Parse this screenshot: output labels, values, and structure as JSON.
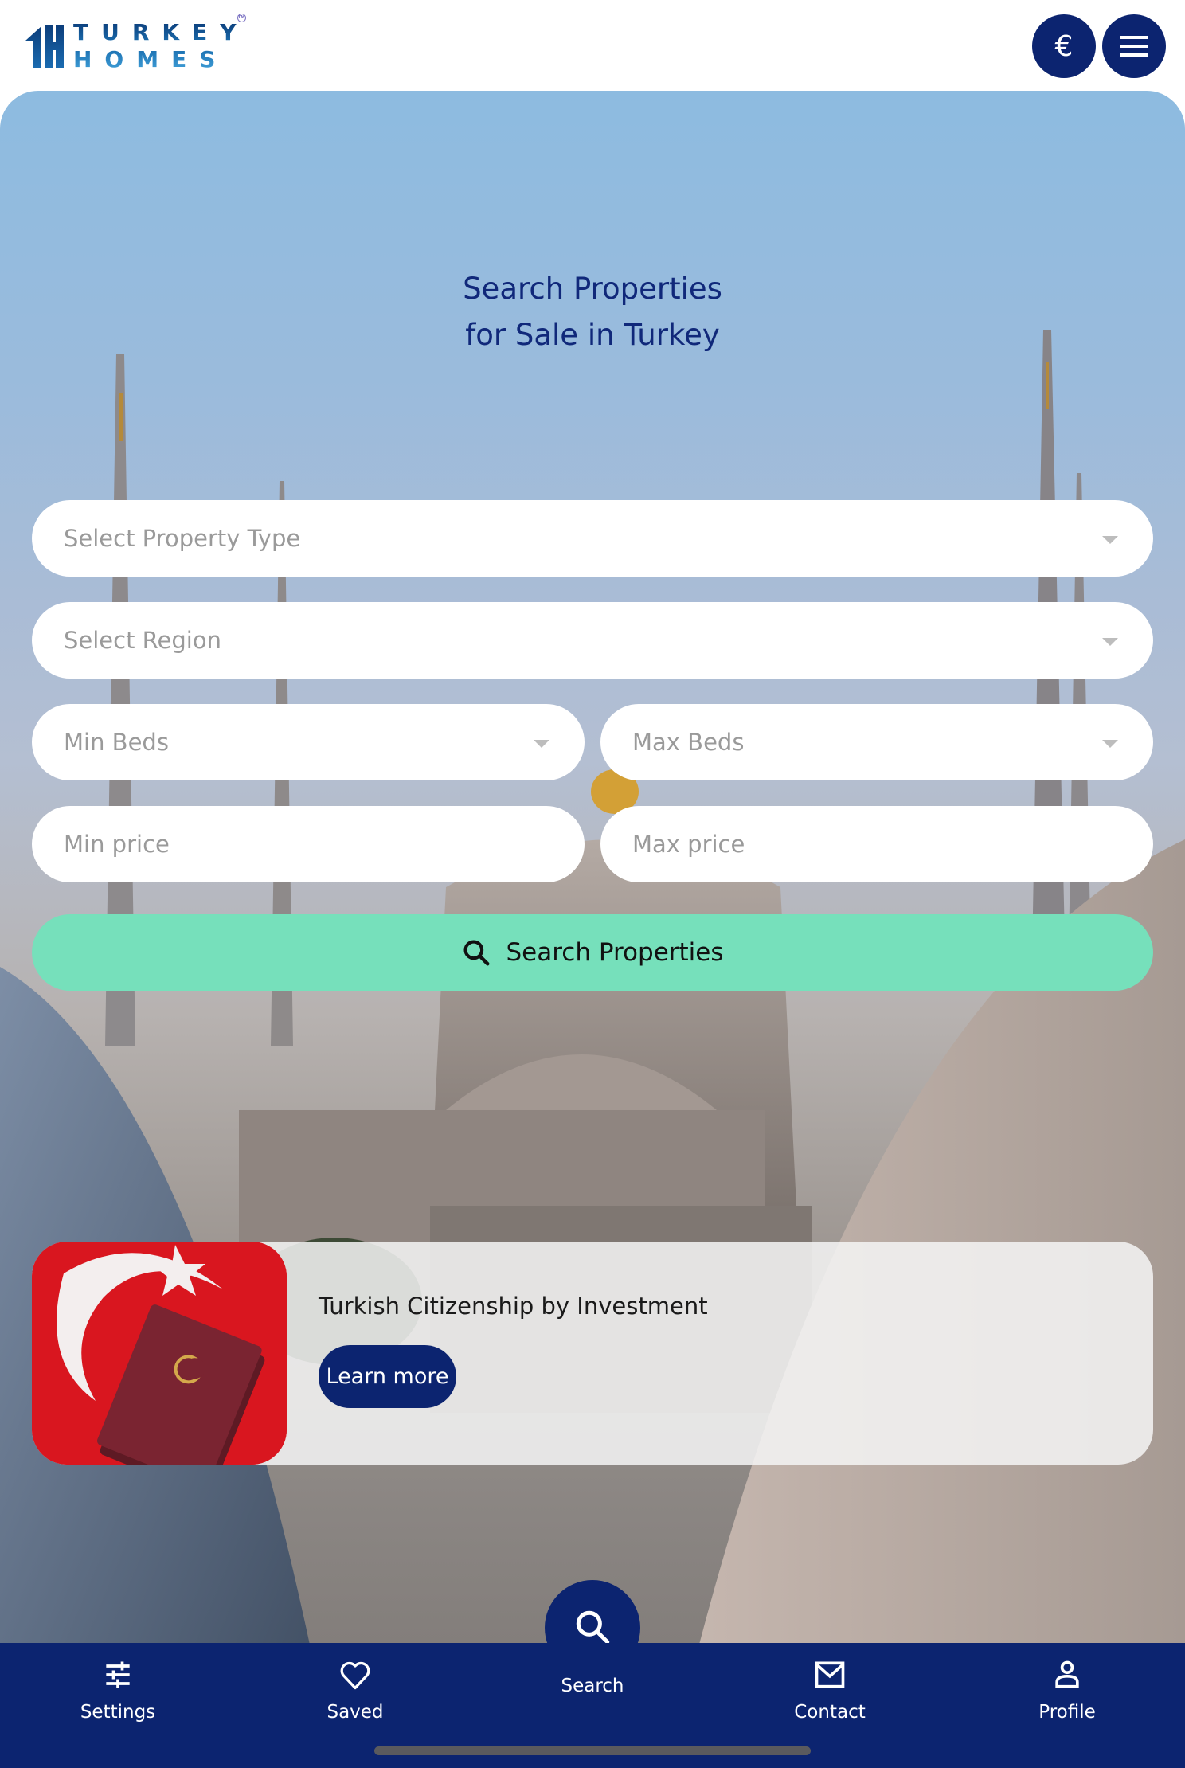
{
  "header": {
    "logo": {
      "line1": "TURKEY",
      "line2": "HOMES",
      "trademark": "TM"
    },
    "currency_button": {
      "symbol": "€",
      "icon": "euro-icon"
    },
    "menu_button": {
      "icon": "hamburger-menu-icon"
    }
  },
  "hero": {
    "title_line1": "Search Properties",
    "title_line2": "for Sale in Turkey"
  },
  "search_form": {
    "property_type": {
      "placeholder": "Select Property Type",
      "icon": "chevron-down-icon"
    },
    "region": {
      "placeholder": "Select Region",
      "icon": "chevron-down-icon"
    },
    "min_beds": {
      "placeholder": "Min Beds",
      "icon": "chevron-down-icon"
    },
    "max_beds": {
      "placeholder": "Max Beds",
      "icon": "chevron-down-icon"
    },
    "min_price": {
      "placeholder": "Min price",
      "value": ""
    },
    "max_price": {
      "placeholder": "Max price",
      "value": ""
    },
    "submit": {
      "label": "Search Properties",
      "icon": "search-icon"
    }
  },
  "promo": {
    "image": "turkish-flag-passport-image",
    "title": "Turkish Citizenship by Investment",
    "button_label": "Learn more"
  },
  "bottom_nav": {
    "items": [
      {
        "label": "Settings",
        "icon": "sliders-icon"
      },
      {
        "label": "Saved",
        "icon": "heart-icon"
      },
      {
        "label": "Search",
        "icon": "search-icon"
      },
      {
        "label": "Contact",
        "icon": "mail-icon"
      },
      {
        "label": "Profile",
        "icon": "person-icon"
      }
    ]
  },
  "colors": {
    "brand_navy": "#0c2470",
    "accent_mint": "#76e0bb",
    "title_blue": "#10287a",
    "placeholder_gray": "#9a9a9a"
  }
}
